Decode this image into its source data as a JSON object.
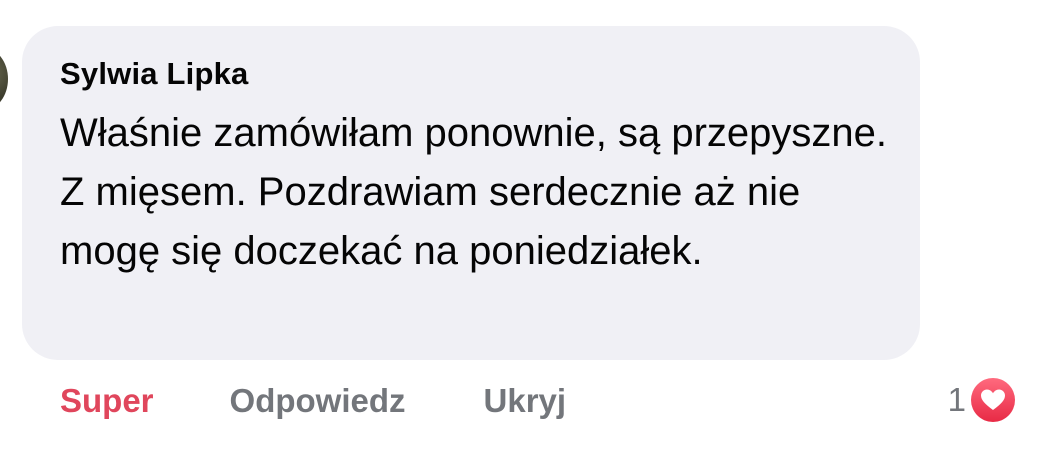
{
  "comment": {
    "author": "Sylwia Lipka",
    "text": "Właśnie zamówiłam ponownie, są przepyszne. Z mięsem. Pozdrawiam serdecznie aż nie mogę się doczekać na poniedziałek."
  },
  "actions": {
    "like_label": "Super",
    "reply_label": "Odpowiedz",
    "hide_label": "Ukryj"
  },
  "reactions": {
    "count": "1",
    "icon": "heart-icon"
  },
  "colors": {
    "like_active": "#e0465c",
    "secondary_text": "#73767b",
    "bubble_bg": "#f0f0f5",
    "heart": "#f0384f"
  }
}
